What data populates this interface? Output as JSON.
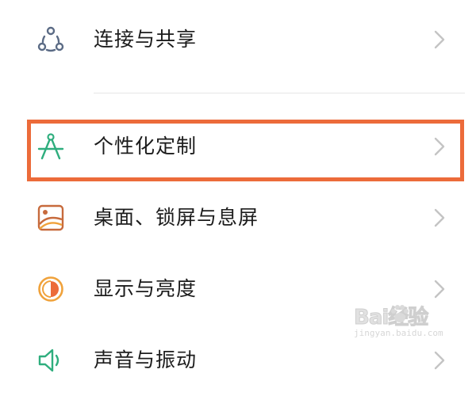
{
  "settings": {
    "items": [
      {
        "label": "连接与共享",
        "icon": "connection-share-icon",
        "icon_color": "#5b6b85"
      },
      {
        "label": "个性化定制",
        "icon": "compass-personalize-icon",
        "icon_color": "#2fae7e"
      },
      {
        "label": "桌面、锁屏与息屏",
        "icon": "wallpaper-icon",
        "icon_color": "#c76a3c"
      },
      {
        "label": "显示与亮度",
        "icon": "brightness-icon",
        "icon_color": "#f0a23b"
      },
      {
        "label": "声音与振动",
        "icon": "sound-icon",
        "icon_color": "#2fae7e"
      }
    ],
    "chevron_color": "#c4c4c4"
  },
  "highlight": {
    "color": "#ec6b3a",
    "target": "个性化定制"
  },
  "watermark": {
    "brand": "Bai经验",
    "url": "jingyan.baidu.com"
  }
}
